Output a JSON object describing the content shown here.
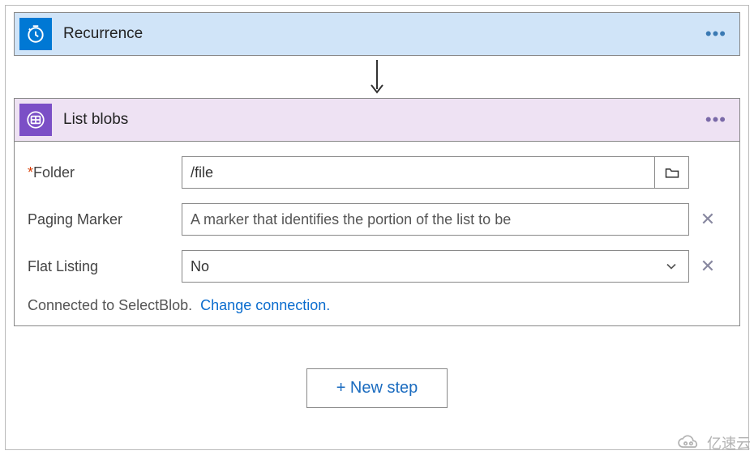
{
  "recurrence": {
    "title": "Recurrence",
    "icon": "clock-icon",
    "accent": "#0078d4"
  },
  "listblobs": {
    "title": "List blobs",
    "icon": "storage-icon",
    "accent": "#7b4fc6",
    "fields": {
      "folder": {
        "label": "Folder",
        "required": true,
        "value": "/file"
      },
      "paging_marker": {
        "label": "Paging Marker",
        "placeholder": "A marker that identifies the portion of the list to be",
        "value": ""
      },
      "flat_listing": {
        "label": "Flat Listing",
        "value": "No"
      }
    },
    "connection": {
      "text": "Connected to SelectBlob.",
      "change": "Change connection."
    }
  },
  "new_step_label": "+ New step",
  "watermark": {
    "text": "亿速云"
  }
}
